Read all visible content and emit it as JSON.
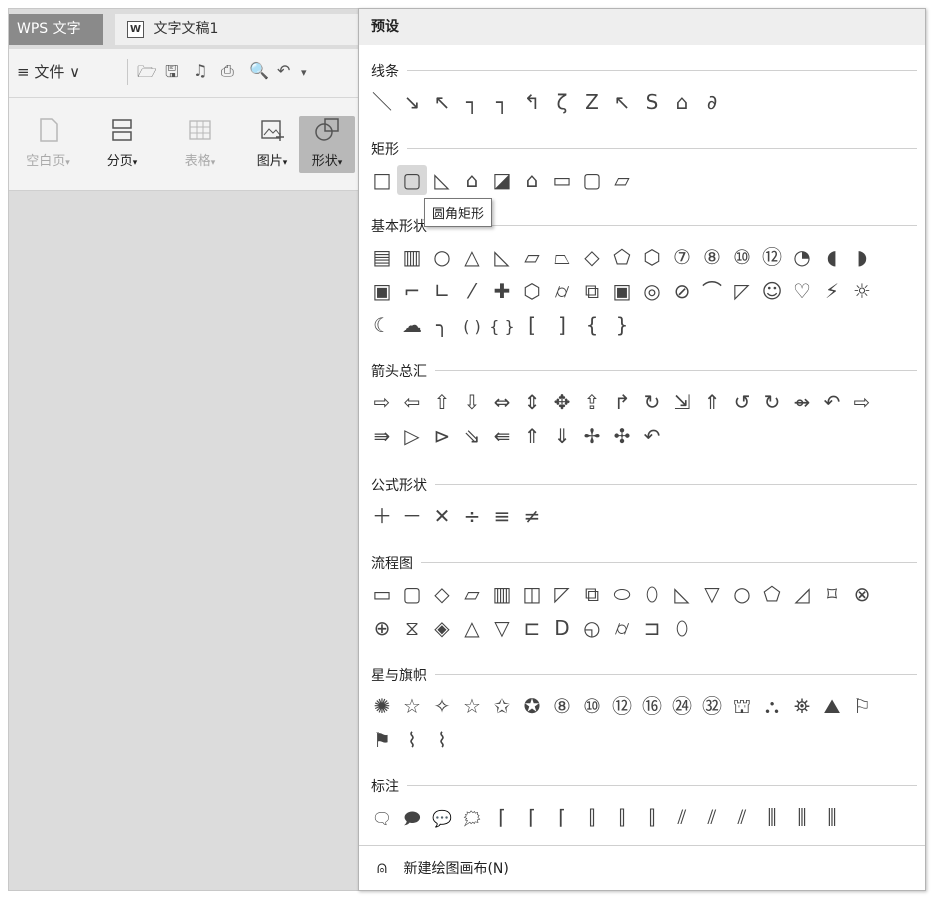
{
  "app": {
    "app_tab": "WPS 文字",
    "doc_icon": "W",
    "doc_tab": "文字文稿1",
    "file_menu": "≡ 文件 ∨",
    "quick_access": [
      "🗁",
      "🖫",
      "♫",
      "⎙",
      "🔍",
      "↶",
      "▾"
    ],
    "ribbon": [
      {
        "label": "空白页",
        "arrow": "▾",
        "icon": "blank-page-icon",
        "dim": true,
        "on": false
      },
      {
        "label": "分页",
        "arrow": "▾",
        "icon": "page-break-icon",
        "dim": false,
        "on": false
      },
      {
        "label": "表格",
        "arrow": "▾",
        "icon": "table-icon",
        "dim": true,
        "on": false
      },
      {
        "label": "图片",
        "arrow": "▾",
        "icon": "picture-icon",
        "dim": false,
        "on": false
      },
      {
        "label": "形状",
        "arrow": "▾",
        "icon": "shape-icon",
        "dim": false,
        "on": true
      }
    ]
  },
  "panel": {
    "title": "预设",
    "tooltip": "圆角矩形",
    "sections": [
      {
        "title": "线条",
        "rows": [
          [
            "＼",
            "↘",
            "↖",
            "┐",
            "┐",
            "↰",
            "ζ",
            "Ζ",
            "↖",
            "S",
            "⌂",
            "∂"
          ]
        ]
      },
      {
        "title": "矩形",
        "rows": [
          [
            "□",
            "▢",
            "◺",
            "⌂",
            "◪",
            "⌂",
            "▭",
            "▢",
            "▱"
          ]
        ]
      },
      {
        "title": "基本形状",
        "rows": [
          [
            "▤",
            "▥",
            "○",
            "△",
            "◺",
            "▱",
            "⏢",
            "◇",
            "⬠",
            "⬡",
            "⑦",
            "⑧",
            "⑩",
            "⑫",
            "◔",
            "◖",
            "◗"
          ],
          [
            "▣",
            "⌐",
            "∟",
            "⁄",
            "✚",
            "⬡",
            "⌭",
            "⧉",
            "▣",
            "◎",
            "⊘",
            "⌒",
            "◸",
            "☺",
            "♡",
            "⚡",
            "☼"
          ],
          [
            "☾",
            "☁",
            "╮",
            "( )",
            "{ }",
            "[",
            "]",
            "{",
            "}"
          ]
        ]
      },
      {
        "title": "箭头总汇",
        "rows": [
          [
            "⇨",
            "⇦",
            "⇧",
            "⇩",
            "⇔",
            "⇕",
            "✥",
            "⇪",
            "↱",
            "↻",
            "⇲",
            "⇑",
            "↺",
            "↻",
            "⇴",
            "↶",
            "⇨"
          ],
          [
            "⇛",
            "▷",
            "⊳",
            "⇘",
            "⇚",
            "⇑",
            "⇓",
            "✢",
            "✣",
            "↶"
          ]
        ]
      },
      {
        "title": "公式形状",
        "rows": [
          [
            "＋",
            "－",
            "✕",
            "÷",
            "≡",
            "≠"
          ]
        ]
      },
      {
        "title": "流程图",
        "rows": [
          [
            "▭",
            "▢",
            "◇",
            "▱",
            "▥",
            "◫",
            "◸",
            "⧉",
            "⬭",
            "⬯",
            "◺",
            "▽",
            "○",
            "⬠",
            "◿",
            "⌑",
            "⊗"
          ],
          [
            "⊕",
            "⧖",
            "◈",
            "△",
            "▽",
            "⊏",
            "D",
            "◵",
            "⌭",
            "⊐",
            "⬯"
          ]
        ]
      },
      {
        "title": "星与旗帜",
        "rows": [
          [
            "✺",
            "☆",
            "✧",
            "☆",
            "✩",
            "✪",
            "⑧",
            "⑩",
            "⑫",
            "⑯",
            "㉔",
            "㉜",
            "⛫",
            "⛬",
            "⛯",
            "⛰",
            "⚐"
          ],
          [
            "⚑",
            "⌇",
            "⌇"
          ]
        ]
      },
      {
        "title": "标注",
        "rows": [
          [
            "🗨",
            "🗩",
            "💬",
            "🗯",
            "⌈",
            "⌈",
            "⌈",
            "⫿",
            "⫿",
            "⫿",
            "⫽",
            "⫽",
            "⫽",
            "⫼",
            "⫼",
            "⫼"
          ]
        ]
      }
    ],
    "footer_icon": "⍝",
    "footer_label": "新建绘图画布(N)"
  }
}
